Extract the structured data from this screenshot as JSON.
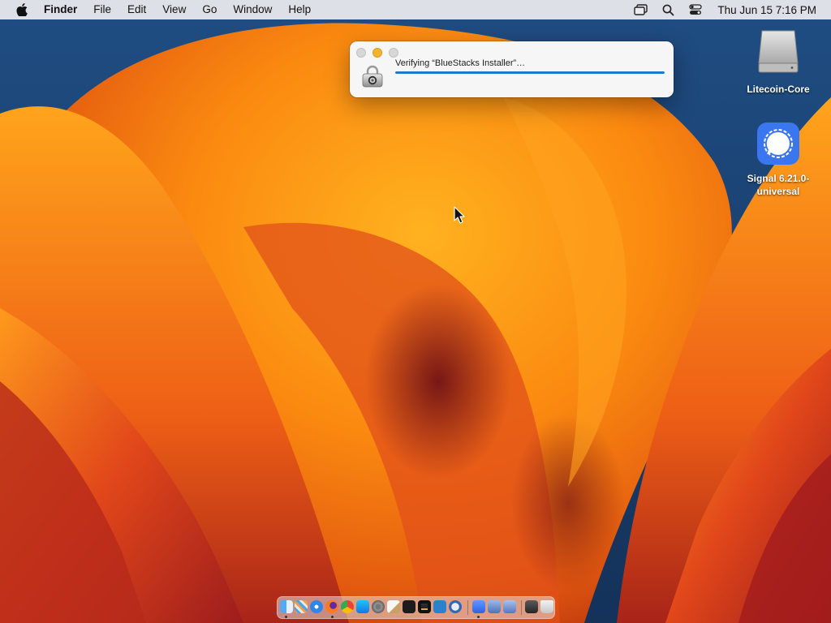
{
  "menubar": {
    "apple_icon": "apple-logo-icon",
    "app_name": "Finder",
    "items": [
      "File",
      "Edit",
      "View",
      "Go",
      "Window",
      "Help"
    ],
    "status_icons": [
      "screen-mirroring-icon",
      "spotlight-search-icon",
      "control-center-icon"
    ],
    "clock": "Thu Jun 15  7:16 PM"
  },
  "progress_window": {
    "message": "Verifying “BlueStacks Installer”…",
    "icon": "gatekeeper-icon",
    "progress_percent": 100,
    "accent_color": "#1f78d1"
  },
  "desktop_icons": [
    {
      "label": "Litecoin-Core",
      "icon": "disk-image-icon"
    },
    {
      "label": "Signal 6.21.0-\nuniversal",
      "icon": "signal-app-icon",
      "color": "#3a76f0"
    }
  ],
  "dock": {
    "apps": [
      {
        "name": "finder-icon",
        "running": true
      },
      {
        "name": "launchpad-icon",
        "running": false
      },
      {
        "name": "safari-icon",
        "running": false
      },
      {
        "name": "firefox-icon",
        "running": true
      },
      {
        "name": "chrome-icon",
        "running": false
      },
      {
        "name": "app-store-icon",
        "running": false
      },
      {
        "name": "system-settings-icon",
        "running": false
      },
      {
        "name": "textedit-icon",
        "running": false
      },
      {
        "name": "terminal-icon",
        "running": false
      },
      {
        "name": "garageband-icon",
        "running": false
      },
      {
        "name": "vscode-icon",
        "running": false
      },
      {
        "name": "litecoin-icon",
        "running": false
      },
      {
        "name": "bluestacks-icon",
        "running": true
      },
      {
        "name": "virtualbox-icon",
        "running": false
      },
      {
        "name": "virtualbox-vm-icon",
        "running": false
      },
      {
        "name": "console-icon",
        "running": false
      },
      {
        "name": "trash-icon",
        "running": false
      }
    ]
  }
}
